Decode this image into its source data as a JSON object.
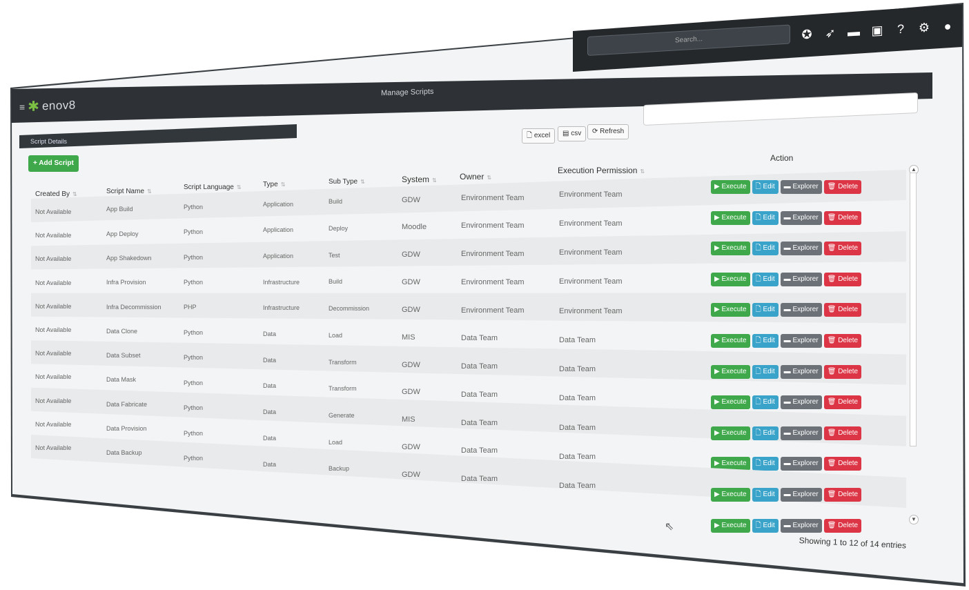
{
  "topbar": {
    "search_placeholder": "Search...",
    "icons": [
      "star-icon",
      "paper-plane-icon",
      "calendar-icon",
      "monitor-icon",
      "help-icon",
      "gear-icon",
      "user-icon"
    ]
  },
  "app": {
    "logo_text": "enov8",
    "page_title": "Manage Scripts"
  },
  "panel": {
    "title": "Script Details",
    "add_button": "+ Add Script",
    "export_buttons": {
      "excel": "excel",
      "csv": "csv",
      "refresh": "Refresh"
    }
  },
  "table": {
    "columns": [
      "Created By",
      "Script Name",
      "Script Language",
      "Type",
      "Sub Type",
      "System",
      "Owner",
      "Execution Permission",
      "Action"
    ],
    "rows": [
      {
        "created_by": "Not Available",
        "name": "App Build",
        "language": "Python",
        "type": "Application",
        "sub_type": "Build",
        "system": "GDW",
        "owner": "Environment Team",
        "permission": "Environment Team"
      },
      {
        "created_by": "Not Available",
        "name": "App Deploy",
        "language": "Python",
        "type": "Application",
        "sub_type": "Deploy",
        "system": "Moodle",
        "owner": "Environment Team",
        "permission": "Environment Team"
      },
      {
        "created_by": "Not Available",
        "name": "App Shakedown",
        "language": "Python",
        "type": "Application",
        "sub_type": "Test",
        "system": "GDW",
        "owner": "Environment Team",
        "permission": "Environment Team"
      },
      {
        "created_by": "Not Available",
        "name": "Infra Provision",
        "language": "Python",
        "type": "Infrastructure",
        "sub_type": "Build",
        "system": "GDW",
        "owner": "Environment Team",
        "permission": "Environment Team"
      },
      {
        "created_by": "Not Available",
        "name": "Infra Decommission",
        "language": "PHP",
        "type": "Infrastructure",
        "sub_type": "Decommission",
        "system": "GDW",
        "owner": "Environment Team",
        "permission": "Environment Team"
      },
      {
        "created_by": "Not Available",
        "name": "Data Clone",
        "language": "Python",
        "type": "Data",
        "sub_type": "Load",
        "system": "MIS",
        "owner": "Data Team",
        "permission": "Data Team"
      },
      {
        "created_by": "Not Available",
        "name": "Data Subset",
        "language": "Python",
        "type": "Data",
        "sub_type": "Transform",
        "system": "GDW",
        "owner": "Data Team",
        "permission": "Data Team"
      },
      {
        "created_by": "Not Available",
        "name": "Data Mask",
        "language": "Python",
        "type": "Data",
        "sub_type": "Transform",
        "system": "GDW",
        "owner": "Data Team",
        "permission": "Data Team"
      },
      {
        "created_by": "Not Available",
        "name": "Data Fabricate",
        "language": "Python",
        "type": "Data",
        "sub_type": "Generate",
        "system": "MIS",
        "owner": "Data Team",
        "permission": "Data Team"
      },
      {
        "created_by": "Not Available",
        "name": "Data Provision",
        "language": "Python",
        "type": "Data",
        "sub_type": "Load",
        "system": "GDW",
        "owner": "Data Team",
        "permission": "Data Team"
      },
      {
        "created_by": "Not Available",
        "name": "Data Backup",
        "language": "Python",
        "type": "Data",
        "sub_type": "Backup",
        "system": "GDW",
        "owner": "Data Team",
        "permission": "Data Team"
      }
    ],
    "actions": {
      "execute": "Execute",
      "edit": "Edit",
      "explorer": "Explorer",
      "delete": "Delete"
    }
  },
  "footer": {
    "info": "Showing 1 to 12 of 14 entries"
  }
}
